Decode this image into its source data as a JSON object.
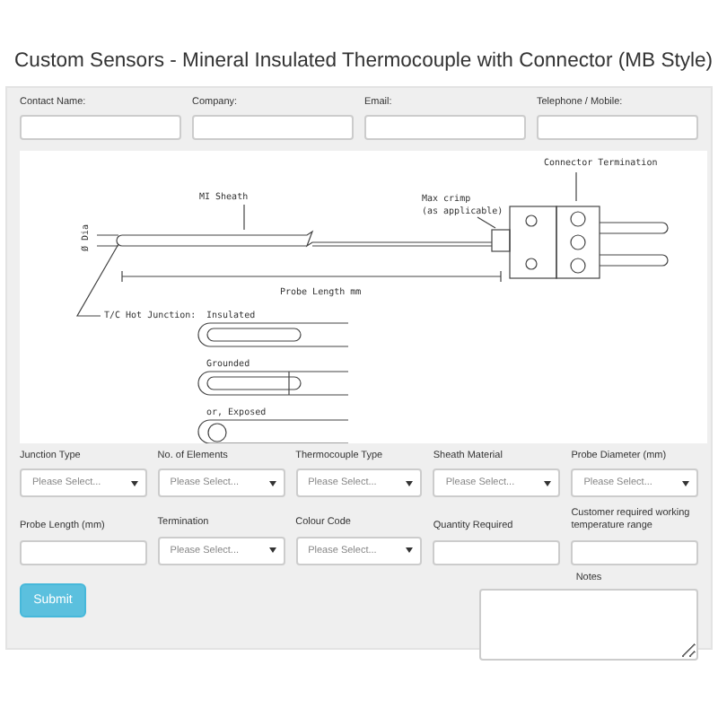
{
  "title": "Custom Sensors - Mineral Insulated Thermocouple with Connector (MB Style)",
  "contact_fields": [
    {
      "label": "Contact Name:"
    },
    {
      "label": "Company:"
    },
    {
      "label": "Email:"
    },
    {
      "label": "Telephone / Mobile:"
    }
  ],
  "drawing": {
    "sheath_label": "MI Sheath",
    "crimp_label": "Max crimp",
    "crimp_note": "(as applicable)",
    "connector_label": "Connector Termination",
    "diameter_label": "Ø Dia",
    "length_label": "Probe Length mm",
    "junction_label": "T/C Hot Junction:",
    "junction_types": [
      "Insulated",
      "Grounded",
      "or, Exposed"
    ]
  },
  "options_row": [
    {
      "label": "Junction Type",
      "kind": "select",
      "value": "Please Select..."
    },
    {
      "label": "No. of Elements",
      "kind": "select",
      "value": "Please Select..."
    },
    {
      "label": "Thermocouple Type",
      "kind": "select",
      "value": "Please Select..."
    },
    {
      "label": "Sheath Material",
      "kind": "select",
      "value": "Please Select..."
    },
    {
      "label": "Probe Diameter (mm)",
      "kind": "select",
      "value": "Please Select..."
    }
  ],
  "details_row": [
    {
      "label": "Probe Length (mm)",
      "kind": "input"
    },
    {
      "label": "Termination",
      "kind": "select",
      "value": "Please Select..."
    },
    {
      "label": "Colour Code",
      "kind": "select",
      "value": "Please Select..."
    },
    {
      "label": "Quantity Required",
      "kind": "input"
    },
    {
      "label": "Customer required working temperature range",
      "kind": "input"
    }
  ],
  "submit": "Submit",
  "notes_label": "Notes"
}
